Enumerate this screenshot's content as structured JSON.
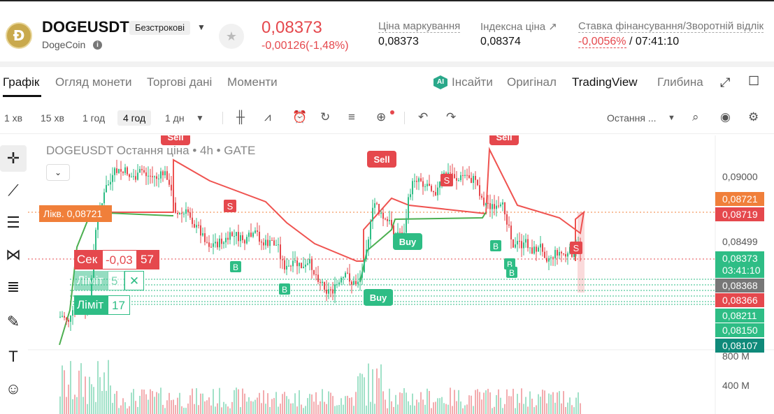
{
  "header": {
    "coin_logo": "Ð",
    "symbol": "DOGEUSDT",
    "contract_type": "Безстрокові",
    "coin_name": "DogeCoin",
    "last_price": "0,08373",
    "price_change": "-0,00126(-1,48%)",
    "mark_price_label": "Ціна маркування",
    "mark_price_value": "0,08373",
    "index_price_label": "Індексна ціна ↗",
    "index_price_value": "0,08374",
    "funding_label": "Ставка фінансування/Зворотній відлік",
    "funding_rate": "-0,0056%",
    "countdown": "/ 07:41:10"
  },
  "tabs": {
    "items": [
      "Графік",
      "Огляд монети",
      "Торгові дані",
      "Моменти"
    ],
    "insights": "Інсайти",
    "original": "Оригінал",
    "tradingview": "TradingView",
    "depth": "Глибина"
  },
  "toolbar": {
    "timeframes": [
      "1 хв",
      "15 хв",
      "1 год",
      "4 год",
      "1 дн"
    ],
    "price_type": "Остання ..."
  },
  "chart": {
    "legend_title": "DOGEUSDT Остання ціна • 4h • GATE",
    "liq_label": "Лікв. 0,08721",
    "order_sek": "Сек",
    "order_sek_value": "-0,03",
    "order_sek_qty": "57",
    "order_limit1": "Ліміт",
    "order_limit1_qty": "5",
    "order_limit2": "Ліміт",
    "order_limit2_qty": "17",
    "price_scale": [
      "0,09000",
      "0,08499"
    ],
    "price_pills": {
      "p1": "0,08721",
      "p2": "0,08719",
      "p3": "0,08373",
      "p3_timer": "03:41:10",
      "p4": "0,08368",
      "p5": "0,08366",
      "p6": "0,08211",
      "p7": "0,08150",
      "p8": "0,08107"
    },
    "volume_scale": [
      "800 M",
      "400 M"
    ],
    "signals": [
      "Sell",
      "Sell",
      "Sell",
      "Buy",
      "Buy"
    ],
    "markers_s": [
      "S",
      "S",
      "S"
    ],
    "markers_b": [
      "B",
      "B",
      "B",
      "B",
      "B"
    ]
  },
  "colors": {
    "up": "#2ebd85",
    "down": "#e5484d",
    "liq": "#f07f3a",
    "supertrend_up": "#4caf50",
    "supertrend_down": "#ef5350"
  }
}
